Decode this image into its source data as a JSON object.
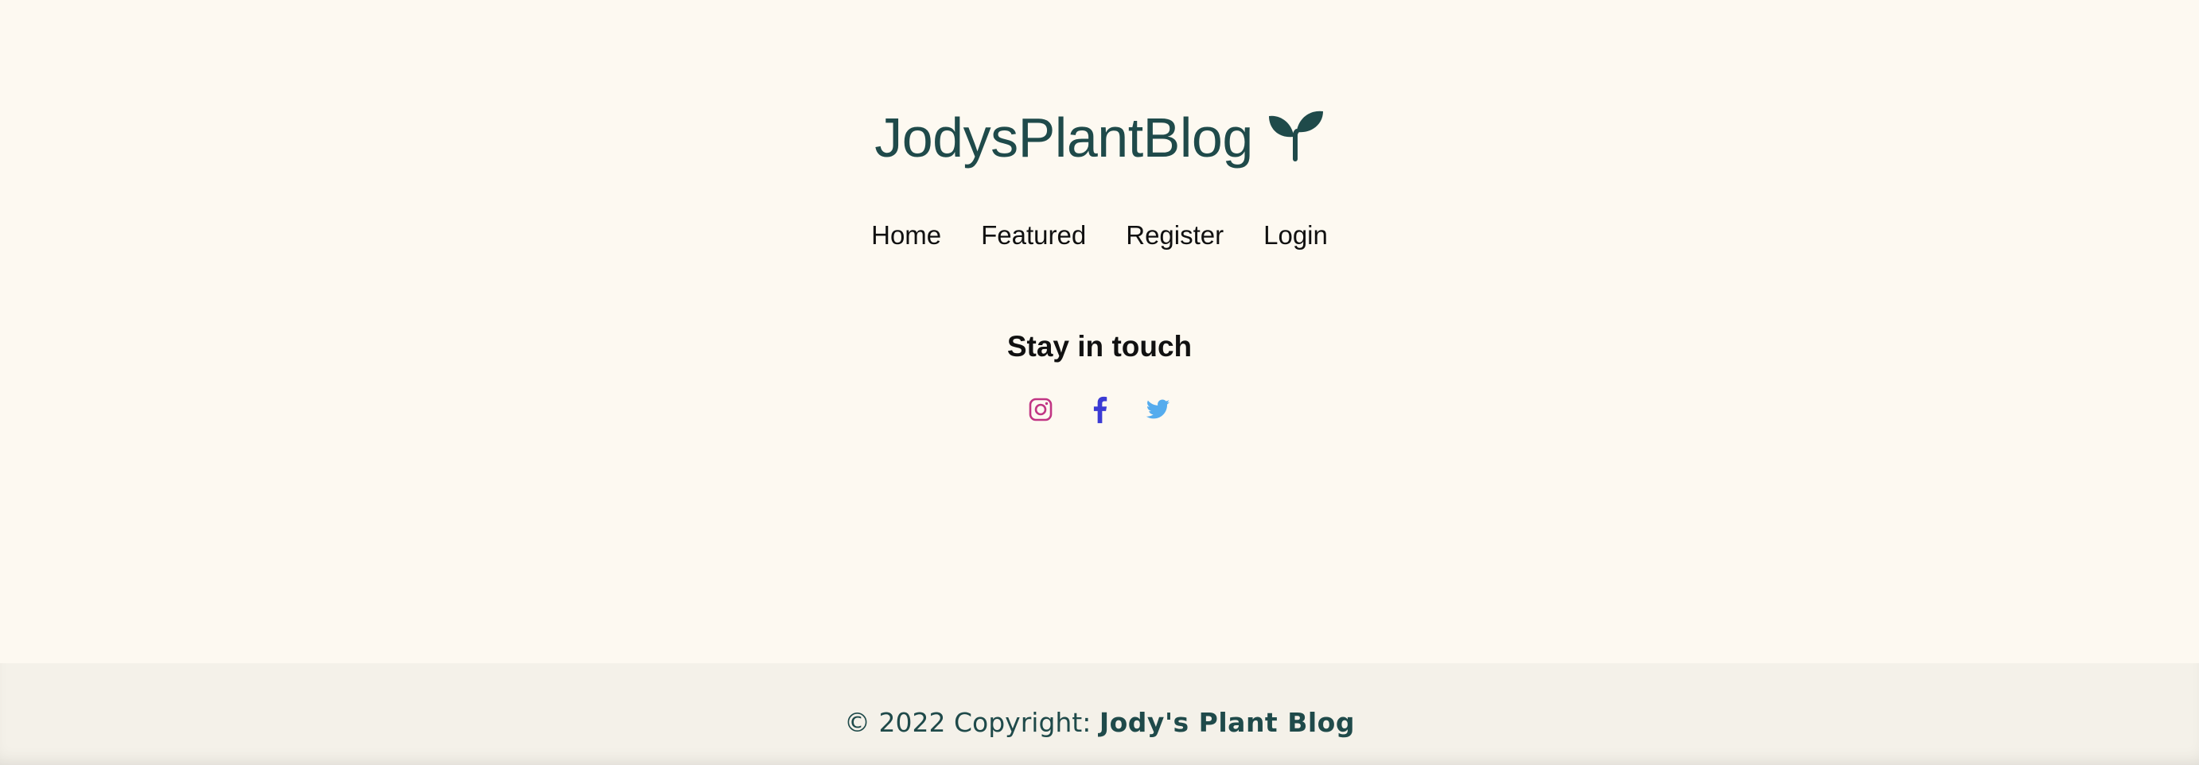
{
  "header": {
    "brand": "JodysPlantBlog",
    "brand_icon": "sprout-icon",
    "brand_color": "#1f4a4a"
  },
  "nav": {
    "items": [
      "Home",
      "Featured",
      "Register",
      "Login"
    ]
  },
  "contact": {
    "title": "Stay in touch",
    "icons": [
      {
        "name": "instagram-icon",
        "color": "#c13584"
      },
      {
        "name": "facebook-icon",
        "color": "#3b3bd4"
      },
      {
        "name": "twitter-icon",
        "color": "#55acee"
      }
    ]
  },
  "footer": {
    "prefix": "© 2022 Copyright: ",
    "owner": "Jody's Plant Blog"
  }
}
